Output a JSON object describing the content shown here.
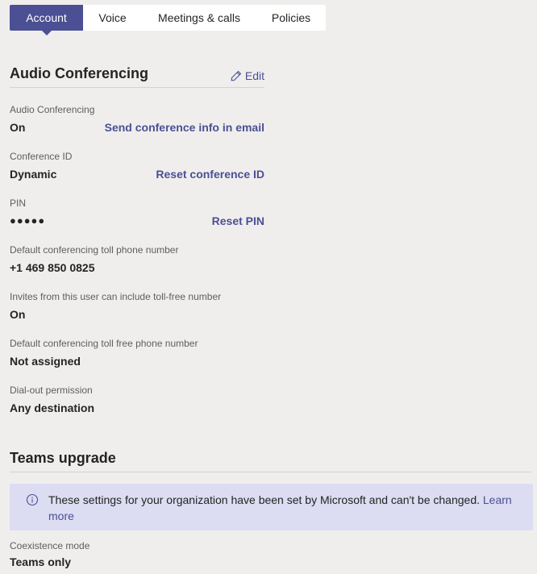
{
  "tabs": [
    {
      "label": "Account",
      "active": true
    },
    {
      "label": "Voice",
      "active": false
    },
    {
      "label": "Meetings & calls",
      "active": false
    },
    {
      "label": "Policies",
      "active": false
    }
  ],
  "audio_conferencing": {
    "title": "Audio Conferencing",
    "edit_label": "Edit",
    "fields": [
      {
        "label": "Audio Conferencing",
        "value": "On",
        "action": "Send conference info in email"
      },
      {
        "label": "Conference ID",
        "value": "Dynamic",
        "action": "Reset conference ID"
      },
      {
        "label": "PIN",
        "value": "●●●●●",
        "action": "Reset PIN"
      },
      {
        "label": "Default conferencing toll phone number",
        "value": "+1 469 850 0825"
      },
      {
        "label": "Invites from this user can include toll-free number",
        "value": "On"
      },
      {
        "label": "Default conferencing toll free phone number",
        "value": "Not assigned"
      },
      {
        "label": "Dial-out permission",
        "value": "Any destination"
      }
    ]
  },
  "teams_upgrade": {
    "title": "Teams upgrade",
    "banner_text": "These settings for your organization have been set by Microsoft and can't be changed.",
    "banner_link": "Learn more",
    "fields": [
      {
        "label": "Coexistence mode",
        "value": "Teams only"
      }
    ]
  },
  "colors": {
    "accent": "#4b4f94",
    "banner_bg": "#dcdcf2",
    "page_bg": "#efeeed"
  },
  "icons": {
    "edit": "pencil-icon",
    "info": "info-icon"
  }
}
